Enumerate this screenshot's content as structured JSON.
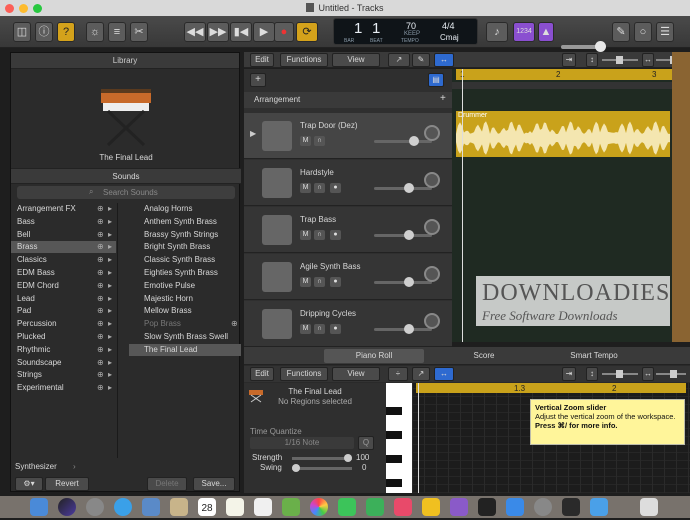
{
  "window": {
    "title": "Untitled - Tracks"
  },
  "lcd": {
    "bar": "1",
    "beat": "1",
    "bar_label": "BAR",
    "beat_label": "BEAT",
    "tempo": "70",
    "tempo_mode": "KEEP",
    "tempo_label": "TEMPO",
    "sig": "4/4",
    "key": "Cmaj"
  },
  "toolbar": {
    "count_in": "1234"
  },
  "library": {
    "title": "Library",
    "preset_name": "The Final Lead",
    "sounds_label": "Sounds",
    "search_placeholder": "Search Sounds",
    "categories": [
      "Arrangement FX",
      "Bass",
      "Bell",
      "Brass",
      "Classics",
      "EDM Bass",
      "EDM Chord",
      "Lead",
      "Pad",
      "Percussion",
      "Plucked",
      "Rhythmic",
      "Soundscape",
      "Strings",
      "Experimental"
    ],
    "patches": [
      "Analog Horns",
      "Anthem Synth Brass",
      "Brassy Synth Strings",
      "Bright Synth Brass",
      "Classic Synth Brass",
      "Eighties Synth Brass",
      "Emotive Pulse",
      "Majestic Horn",
      "Mellow Brass",
      "Pop Brass",
      "Slow Synth Brass Swell",
      "The Final Lead"
    ],
    "footer_label": "Synthesizer",
    "revert": "Revert",
    "delete": "Delete",
    "save": "Save..."
  },
  "tracks": {
    "menus": [
      "Edit",
      "Functions",
      "View"
    ],
    "arrangement_label": "Arrangement",
    "add": "+",
    "list": [
      {
        "name": "Trap Door (Dez)",
        "vol": 0.7
      },
      {
        "name": "Hardstyle",
        "vol": 0.6
      },
      {
        "name": "Trap Bass",
        "vol": 0.6
      },
      {
        "name": "Agile Synth Bass",
        "vol": 0.6
      },
      {
        "name": "Dripping Cycles",
        "vol": 0.6
      }
    ],
    "ruler": [
      "1",
      "2",
      "3"
    ],
    "region_label": "Drummer"
  },
  "editor": {
    "tabs": [
      "Piano Roll",
      "Score",
      "Smart Tempo"
    ],
    "menus": [
      "Edit",
      "Functions",
      "View"
    ],
    "track_name": "The Final Lead",
    "region_info": "No Regions selected",
    "quantize_title": "Time Quantize",
    "quantize_value": "1/16 Note",
    "q_button": "Q",
    "strength_label": "Strength",
    "strength_value": "100",
    "strength": 1.0,
    "swing_label": "Swing",
    "swing_value": "0",
    "swing": 0.0,
    "ruler": [
      "1.3",
      "2"
    ]
  },
  "tooltip": {
    "title": "Vertical Zoom slider",
    "body": "Adjust the vertical zoom of the workspace.",
    "shortcut": "Press ⌘/ for more info."
  },
  "watermark": {
    "title": "DOWNLOADIES",
    "subtitle": "Free Software Downloads"
  },
  "dock": {
    "calendar_day": "28"
  }
}
